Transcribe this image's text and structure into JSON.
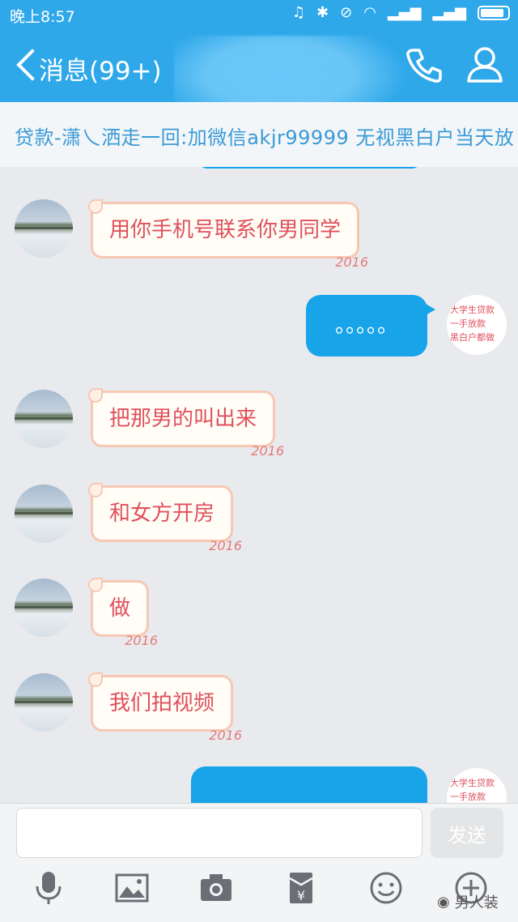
{
  "status_bar": {
    "time": "晚上8:57"
  },
  "header": {
    "back_label": "消息(99+)"
  },
  "banner": {
    "text": "贷款-潇乀洒走一回:加微信akjr99999  无视黑白户当天放"
  },
  "messages": [
    {
      "side": "left",
      "text": "用你手机号联系你男同学"
    },
    {
      "side": "right",
      "text": "。。。。。"
    },
    {
      "side": "left",
      "text": "把那男的叫出来"
    },
    {
      "side": "left",
      "text": "和女方开房"
    },
    {
      "side": "left",
      "text": "做"
    },
    {
      "side": "left",
      "text": "我们拍视频"
    }
  ],
  "bubble_deco": "2016",
  "my_avatar_lines": [
    "大学生贷款",
    "一手放款",
    "黑白户都做"
  ],
  "input": {
    "placeholder": "",
    "send_label": "发送"
  },
  "toolbar": [
    "mic-icon",
    "image-icon",
    "camera-icon",
    "red-packet-icon",
    "emoji-icon",
    "more-icon"
  ],
  "watermark": "男人装",
  "colors": {
    "header": "#2fa8ea",
    "bubble_right": "#17a4e9",
    "bubble_left_text": "#e0505c",
    "background": "#e9eaed"
  }
}
